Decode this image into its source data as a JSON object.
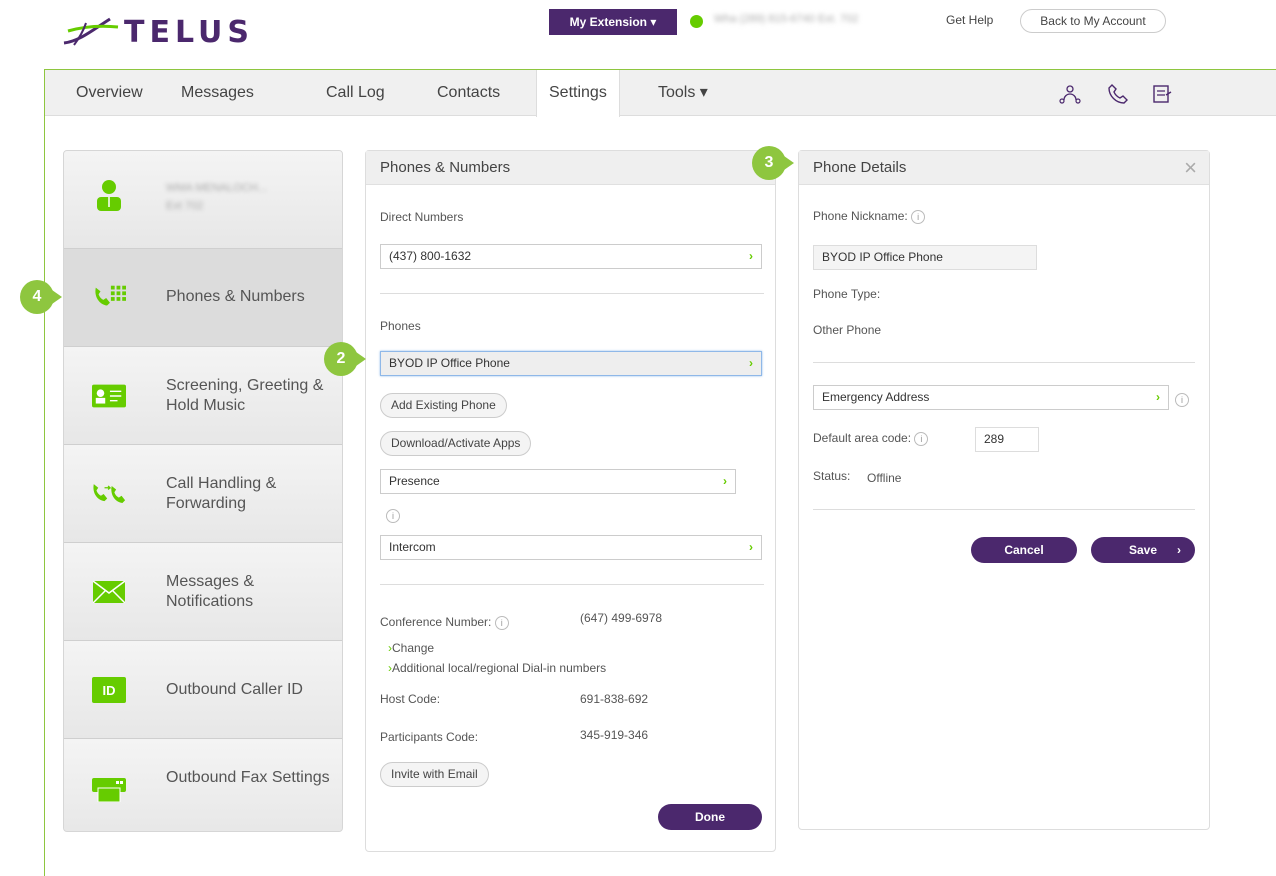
{
  "brand": {
    "logo_text": "TELUS",
    "accent": "#4b286d",
    "green": "#66cc00",
    "border_green": "#8ec63f"
  },
  "header": {
    "extension_label": "My Extension ▾",
    "user_info": "Wha (289) 815-6740 Ext. 702",
    "get_help": "Get Help",
    "back_to_account": "Back to My Account"
  },
  "nav": {
    "tabs": [
      {
        "label": "Overview"
      },
      {
        "label": "Messages"
      },
      {
        "label": "Call Log"
      },
      {
        "label": "Contacts"
      },
      {
        "label": "Settings"
      },
      {
        "label": "Tools ▾"
      }
    ],
    "icons": [
      "presence-icon",
      "phone-icon",
      "compose-icon"
    ]
  },
  "left_menu": {
    "user_name": "WMA MENALOCH...",
    "user_ext": "Ext 702",
    "items": [
      {
        "label": "Phones & Numbers"
      },
      {
        "label": "Screening, Greeting & Hold Music"
      },
      {
        "label": "Call Handling & Forwarding"
      },
      {
        "label": "Messages & Notifications"
      },
      {
        "label": "Outbound Caller ID"
      },
      {
        "label": "Outbound Fax Settings"
      }
    ],
    "id_icon_text": "ID"
  },
  "badges": {
    "b2": "2",
    "b3": "3",
    "b4": "4"
  },
  "phones_numbers": {
    "title": "Phones & Numbers",
    "direct_numbers_label": "Direct Numbers",
    "direct_number": "(437) 800-1632",
    "phones_label": "Phones",
    "selected_phone": "BYOD IP Office Phone",
    "add_existing": "Add Existing Phone",
    "download_apps": "Download/Activate Apps",
    "presence": "Presence",
    "intercom": "Intercom",
    "conference_label": "Conference Number:",
    "conference_number": "(647) 499-6978",
    "change": "Change",
    "additional": "Additional local/regional Dial-in numbers",
    "host_code_label": "Host Code:",
    "host_code": "691-838-692",
    "participants_label": "Participants Code:",
    "participants_code": "345-919-346",
    "invite": "Invite with Email",
    "done": "Done"
  },
  "phone_details": {
    "title": "Phone Details",
    "nickname_label": "Phone Nickname:",
    "nickname_value": "BYOD IP Office Phone",
    "type_label": "Phone Type:",
    "type_value": "Other Phone",
    "emergency": "Emergency Address",
    "area_code_label": "Default area code:",
    "area_code_value": "289",
    "status_label": "Status:",
    "status_value": "Offline",
    "cancel": "Cancel",
    "save": "Save"
  }
}
